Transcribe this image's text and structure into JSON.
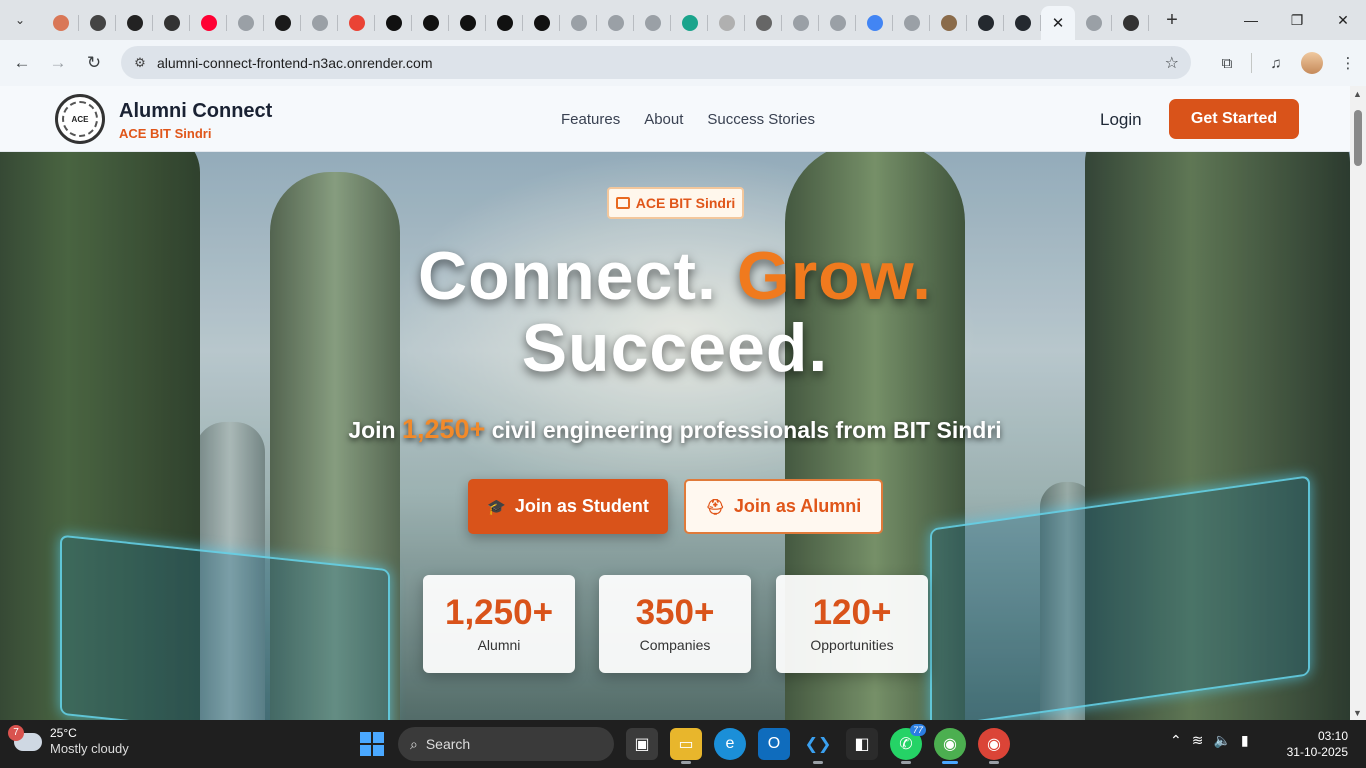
{
  "browser": {
    "tabs": [
      {
        "icon": "claude-icon",
        "color": "#d97757"
      },
      {
        "icon": "openai-icon",
        "color": "#444444"
      },
      {
        "icon": "x-icon",
        "color": "#222222"
      },
      {
        "icon": "gpt-icon",
        "color": "#333333"
      },
      {
        "icon": "youtube-icon",
        "color": "#ff0033"
      },
      {
        "icon": "globe-icon",
        "color": "#9aa0a6"
      },
      {
        "icon": "spotify-icon",
        "color": "#1a1a1a"
      },
      {
        "icon": "globe-icon",
        "color": "#9aa0a6"
      },
      {
        "icon": "google-icon",
        "color": "#ea4335"
      },
      {
        "icon": "perplexity-icon",
        "color": "#111111"
      },
      {
        "icon": "perplexity-icon",
        "color": "#111111"
      },
      {
        "icon": "perplexity-icon",
        "color": "#111111"
      },
      {
        "icon": "perplexity-icon",
        "color": "#111111"
      },
      {
        "icon": "perplexity-icon",
        "color": "#111111"
      },
      {
        "icon": "globe-icon",
        "color": "#9aa0a6"
      },
      {
        "icon": "globe-icon",
        "color": "#9aa0a6"
      },
      {
        "icon": "globe-icon",
        "color": "#9aa0a6"
      },
      {
        "icon": "diamond-icon",
        "color": "#1aa48c"
      },
      {
        "icon": "vercel-icon",
        "color": "#b0b0b0"
      },
      {
        "icon": "crosshair-icon",
        "color": "#666666"
      },
      {
        "icon": "globe-icon",
        "color": "#9aa0a6"
      },
      {
        "icon": "globe-icon",
        "color": "#9aa0a6"
      },
      {
        "icon": "google-icon",
        "color": "#4285f4"
      },
      {
        "icon": "globe-icon",
        "color": "#9aa0a6"
      },
      {
        "icon": "avatar-icon",
        "color": "#8a6b4a"
      },
      {
        "icon": "github-icon",
        "color": "#24292f"
      },
      {
        "icon": "github-icon",
        "color": "#24292f"
      }
    ],
    "active_tab_close": "✕",
    "after_tabs": [
      {
        "icon": "globe-icon",
        "color": "#9aa0a6"
      },
      {
        "icon": "gpt-icon",
        "color": "#333333"
      }
    ],
    "new_tab": "+",
    "url": "alumni-connect-frontend-n3ac.onrender.com"
  },
  "site": {
    "brand_title": "Alumni Connect",
    "brand_subtitle": "ACE BIT Sindri",
    "logo_text": "ACE",
    "nav": [
      "Features",
      "About",
      "Success Stories"
    ],
    "login": "Login",
    "get_started": "Get Started",
    "accent": "#d9531a"
  },
  "hero": {
    "badge": "ACE BIT Sindri",
    "headline_part1": "Connect.",
    "headline_part2": "Grow.",
    "headline_part3": "Succeed.",
    "tagline_before": "Join",
    "tagline_number": "1,250+",
    "tagline_after": "civil engineering professionals from BIT Sindri",
    "btn_student": "Join as Student",
    "btn_alumni": "Join as Alumni",
    "stats": [
      {
        "value": "1,250+",
        "label": "Alumni"
      },
      {
        "value": "350+",
        "label": "Companies"
      },
      {
        "value": "120+",
        "label": "Opportunities"
      }
    ]
  },
  "taskbar": {
    "weather_badge": "7",
    "temperature": "25°C",
    "condition": "Mostly cloudy",
    "search_label": "Search",
    "whatsapp_badge": "77",
    "time": "03:10",
    "date": "31-10-2025"
  }
}
